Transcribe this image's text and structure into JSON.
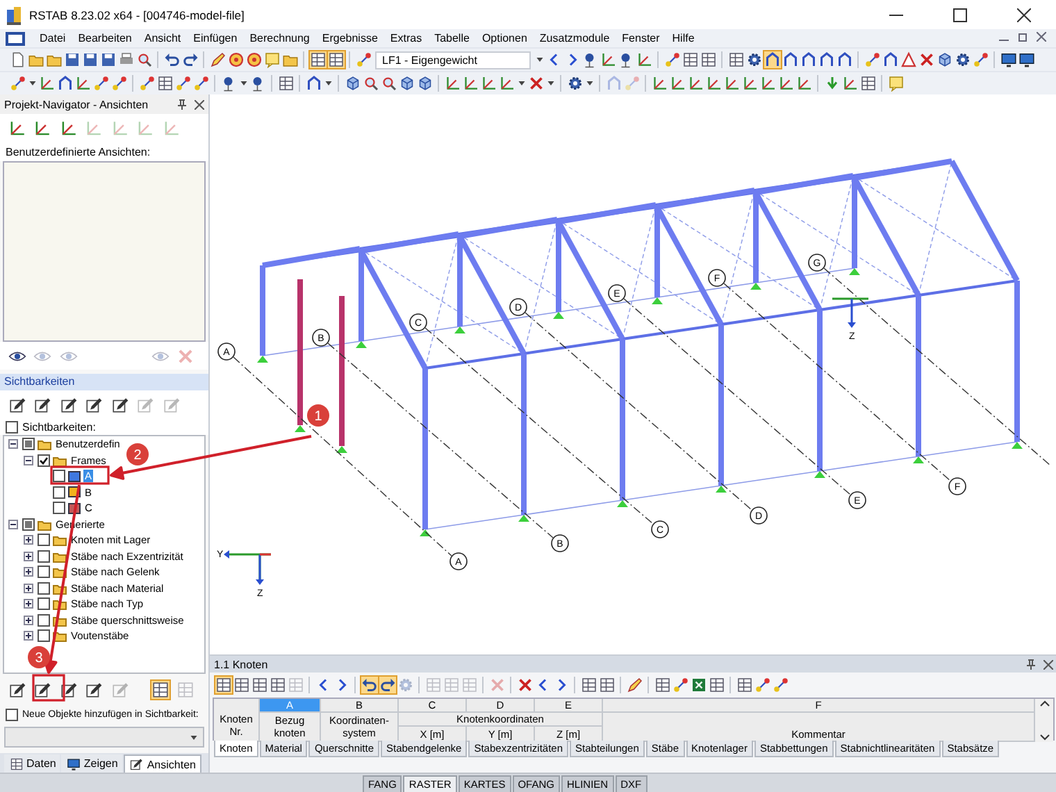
{
  "window": {
    "title": "RSTAB 8.23.02 x64 - [004746-model-file]"
  },
  "menu": [
    "Datei",
    "Bearbeiten",
    "Ansicht",
    "Einfügen",
    "Berechnung",
    "Ergebnisse",
    "Extras",
    "Tabelle",
    "Optionen",
    "Zusatzmodule",
    "Fenster",
    "Hilfe"
  ],
  "load_case": {
    "value": "LF1 - Eigengewicht"
  },
  "navigator": {
    "title": "Projekt-Navigator - Ansichten",
    "views_label": "Benutzerdefinierte Ansichten:",
    "visibility_header": "Sichtbarkeiten",
    "visibility_toggle": {
      "label": "Sichtbarkeiten:",
      "checked": false
    },
    "tree": [
      {
        "label": "Benutzerdefin",
        "kind": "folder",
        "checked": false,
        "partial": true,
        "expanded": true,
        "selected": false,
        "children": [
          {
            "label": "Frames",
            "kind": "folder",
            "checked": true,
            "partial": false,
            "expanded": true,
            "selected": false,
            "children": [
              {
                "label": "A",
                "kind": "swatch",
                "color": "#3f78e0",
                "checked": false,
                "partial": false,
                "selected": true
              },
              {
                "label": "B",
                "kind": "swatch",
                "color": "#f2b21e",
                "checked": false,
                "partial": false,
                "selected": false
              },
              {
                "label": "C",
                "kind": "swatch",
                "color": "#c25a5a",
                "checked": false,
                "partial": false,
                "selected": false
              }
            ]
          }
        ]
      },
      {
        "label": "Generierte",
        "kind": "folder",
        "checked": false,
        "partial": true,
        "expanded": true,
        "selected": false,
        "children": [
          {
            "label": "Knoten mit Lager",
            "kind": "folder",
            "checked": false,
            "partial": false,
            "expanded": false,
            "selected": false
          },
          {
            "label": "Stäbe nach Exzentrizität",
            "kind": "folder",
            "checked": false,
            "partial": false,
            "expanded": false,
            "selected": false
          },
          {
            "label": "Stäbe nach Gelenk",
            "kind": "folder",
            "checked": false,
            "partial": false,
            "expanded": false,
            "selected": false
          },
          {
            "label": "Stäbe nach Material",
            "kind": "folder",
            "checked": false,
            "partial": false,
            "expanded": false,
            "selected": false
          },
          {
            "label": "Stäbe nach Typ",
            "kind": "folder",
            "checked": false,
            "partial": false,
            "expanded": false,
            "selected": false
          },
          {
            "label": "Stäbe querschnittsweise",
            "kind": "folder",
            "checked": false,
            "partial": false,
            "expanded": false,
            "selected": false
          },
          {
            "label": "Voutenstäbe",
            "kind": "folder",
            "checked": false,
            "partial": false,
            "expanded": false,
            "selected": false
          }
        ]
      }
    ],
    "new_objects": {
      "label": "Neue Objekte hinzufügen in Sichtbarkeit:",
      "checked": false
    },
    "tabs": [
      {
        "label": "Daten",
        "selected": false
      },
      {
        "label": "Zeigen",
        "selected": false
      },
      {
        "label": "Ansichten",
        "selected": true
      }
    ]
  },
  "view": {
    "grid_labels_back": [
      "A",
      "B",
      "C",
      "D",
      "E",
      "F",
      "G"
    ],
    "grid_labels_front": [
      "A",
      "B",
      "C",
      "D",
      "E",
      "F"
    ],
    "global_axes": [
      "Y",
      "Z"
    ],
    "local_axis": "Z"
  },
  "table": {
    "title": "1.1 Knoten",
    "columns": [
      {
        "letter": "A",
        "selected": true
      },
      {
        "letter": "B",
        "selected": false
      },
      {
        "letter": "C",
        "selected": false
      },
      {
        "letter": "D",
        "selected": false
      },
      {
        "letter": "E",
        "selected": false
      },
      {
        "letter": "F",
        "selected": false
      }
    ],
    "headers": {
      "row": "Knoten Nr.",
      "reference": "Bezug knoten",
      "system": "Koordinaten-system",
      "coordinates": "Knotenkoordinaten",
      "x": "X [m]",
      "y": "Y [m]",
      "z": "Z [m]",
      "comment": "Kommentar"
    },
    "sheets": [
      {
        "label": "Knoten",
        "selected": true
      },
      {
        "label": "Material",
        "selected": false
      },
      {
        "label": "Querschnitte",
        "selected": false
      },
      {
        "label": "Stabendgelenke",
        "selected": false
      },
      {
        "label": "Stabexzentrizitäten",
        "selected": false
      },
      {
        "label": "Stabteilungen",
        "selected": false
      },
      {
        "label": "Stäbe",
        "selected": false
      },
      {
        "label": "Knotenlager",
        "selected": false
      },
      {
        "label": "Stabbettungen",
        "selected": false
      },
      {
        "label": "Stabnichtlinearitäten",
        "selected": false
      },
      {
        "label": "Stabsätze",
        "selected": false
      }
    ]
  },
  "status_bar": [
    {
      "label": "FANG",
      "on": false
    },
    {
      "label": "RASTER",
      "on": true
    },
    {
      "label": "KARTES",
      "on": false
    },
    {
      "label": "OFANG",
      "on": false
    },
    {
      "label": "HLINIEN",
      "on": false
    },
    {
      "label": "DXF",
      "on": false
    }
  ],
  "callouts": [
    "1",
    "2",
    "3"
  ]
}
